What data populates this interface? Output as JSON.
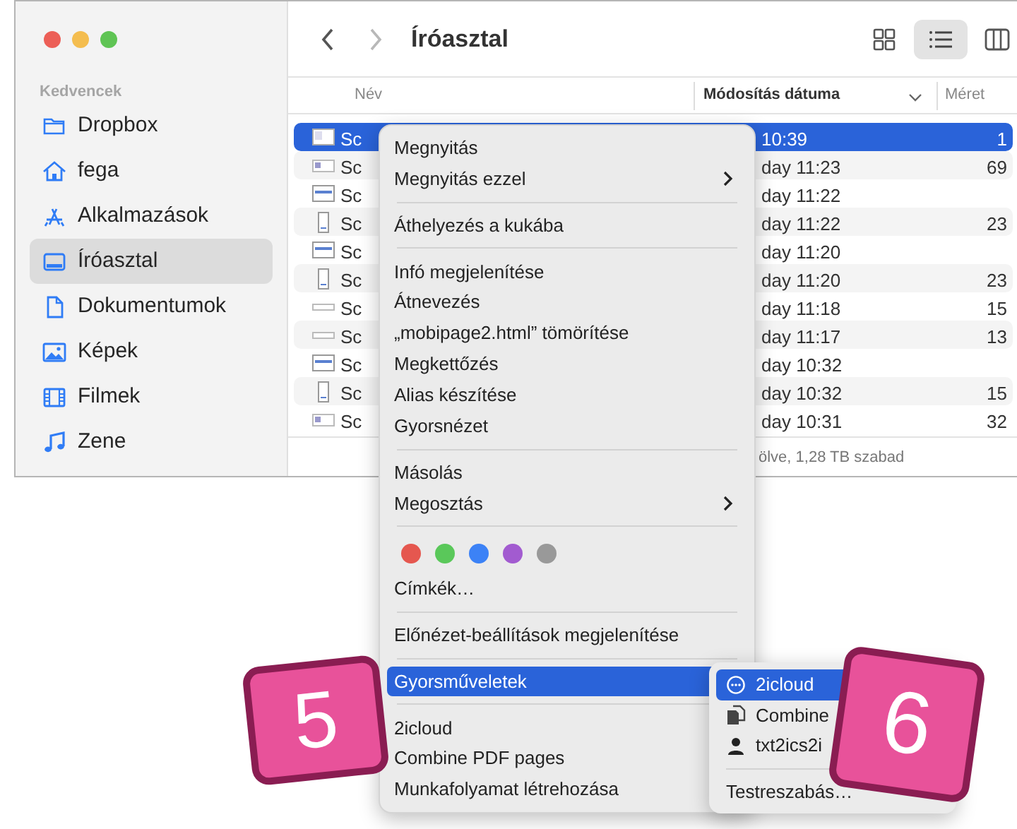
{
  "window": {
    "title": "Íróasztal"
  },
  "sidebar": {
    "section": "Kedvencek",
    "items": [
      {
        "label": "Dropbox",
        "selected": false
      },
      {
        "label": "fega",
        "selected": false
      },
      {
        "label": "Alkalmazások",
        "selected": false
      },
      {
        "label": "Íróasztal",
        "selected": true
      },
      {
        "label": "Dokumentumok",
        "selected": false
      },
      {
        "label": "Képek",
        "selected": false
      },
      {
        "label": "Filmek",
        "selected": false
      },
      {
        "label": "Zene",
        "selected": false
      }
    ]
  },
  "toolbar": {
    "views": [
      {
        "selected": false
      },
      {
        "selected": true
      },
      {
        "selected": false
      }
    ]
  },
  "table": {
    "columns": [
      {
        "label": "Név",
        "sorted": false
      },
      {
        "label": "Módosítás dátuma",
        "sorted": true
      },
      {
        "label": "Méret",
        "sorted": false
      }
    ],
    "rows": [
      {
        "name": "Sc",
        "modified": "10:39",
        "size": "1",
        "selected": true
      },
      {
        "name": "Sc",
        "modified": "day 11:23",
        "size": "69",
        "selected": false
      },
      {
        "name": "Sc",
        "modified": "day 11:22",
        "selected": false
      },
      {
        "name": "Sc",
        "modified": "day 11:22",
        "size": "23",
        "selected": false
      },
      {
        "name": "Sc",
        "modified": "day 11:20",
        "selected": false
      },
      {
        "name": "Sc",
        "modified": "day 11:20",
        "size": "23",
        "selected": false
      },
      {
        "name": "Sc",
        "modified": "day 11:18",
        "size": "15",
        "selected": false
      },
      {
        "name": "Sc",
        "modified": "day 11:17",
        "size": "13",
        "selected": false
      },
      {
        "name": "Sc",
        "modified": "day 10:32",
        "selected": false
      },
      {
        "name": "Sc",
        "modified": "day 10:32",
        "size": "15",
        "selected": false
      },
      {
        "name": "Sc",
        "modified": "day 10:31",
        "size": "32",
        "selected": false
      }
    ]
  },
  "status_bar": "ölve, 1,28 TB szabad",
  "context_menu": {
    "items": [
      {
        "kind": "item",
        "label": "Megnyitás",
        "submenu": false,
        "selected": false
      },
      {
        "kind": "item",
        "label": "Megnyitás ezzel",
        "submenu": true,
        "selected": false
      },
      {
        "kind": "separator"
      },
      {
        "kind": "item",
        "label": "Áthelyezés a kukába",
        "submenu": false,
        "selected": false
      },
      {
        "kind": "separator"
      },
      {
        "kind": "item",
        "label": "Infó megjelenítése",
        "submenu": false,
        "selected": false
      },
      {
        "kind": "item",
        "label": "Átnevezés",
        "submenu": false,
        "selected": false
      },
      {
        "kind": "item",
        "label": "„mobipage2.html” tömörítése",
        "submenu": false,
        "selected": false
      },
      {
        "kind": "item",
        "label": "Megkettőzés",
        "submenu": false,
        "selected": false
      },
      {
        "kind": "item",
        "label": "Alias készítése",
        "submenu": false,
        "selected": false
      },
      {
        "kind": "item",
        "label": "Gyorsnézet",
        "submenu": false,
        "selected": false
      },
      {
        "kind": "separator"
      },
      {
        "kind": "item",
        "label": "Másolás",
        "submenu": false,
        "selected": false
      },
      {
        "kind": "item",
        "label": "Megosztás",
        "submenu": true,
        "selected": false
      },
      {
        "kind": "separator"
      },
      {
        "kind": "tags",
        "colors": [
          {
            "color": "#e5574f"
          },
          {
            "color": "#5ac85a"
          },
          {
            "color": "#3c82f6"
          },
          {
            "color": "#a25bd0"
          },
          {
            "color": "#999999"
          }
        ]
      },
      {
        "kind": "item",
        "label": "Címkék…",
        "submenu": false,
        "selected": false
      },
      {
        "kind": "separator"
      },
      {
        "kind": "item",
        "label": "Előnézet-beállítások megjelenítése",
        "submenu": false,
        "selected": false
      },
      {
        "kind": "separator"
      },
      {
        "kind": "item",
        "label": "Gyorsműveletek",
        "submenu": false,
        "selected": true
      },
      {
        "kind": "separator"
      },
      {
        "kind": "item",
        "label": "2icloud",
        "submenu": false,
        "selected": false
      },
      {
        "kind": "item",
        "label": "Combine PDF pages",
        "submenu": false,
        "selected": false
      },
      {
        "kind": "item",
        "label": "Munkafolyamat létrehozása",
        "submenu": false,
        "selected": false
      }
    ]
  },
  "submenu": {
    "items": [
      {
        "kind": "action",
        "label": "2icloud",
        "selected": true
      },
      {
        "kind": "document",
        "label": "Combine",
        "selected": false
      },
      {
        "kind": "person",
        "label": "txt2ics2i",
        "selected": false
      },
      {
        "kind": "separator"
      },
      {
        "kind": "plain",
        "label": "Testreszabás…",
        "selected": false
      }
    ]
  },
  "badges": [
    {
      "label": "5"
    },
    {
      "label": "6"
    }
  ]
}
